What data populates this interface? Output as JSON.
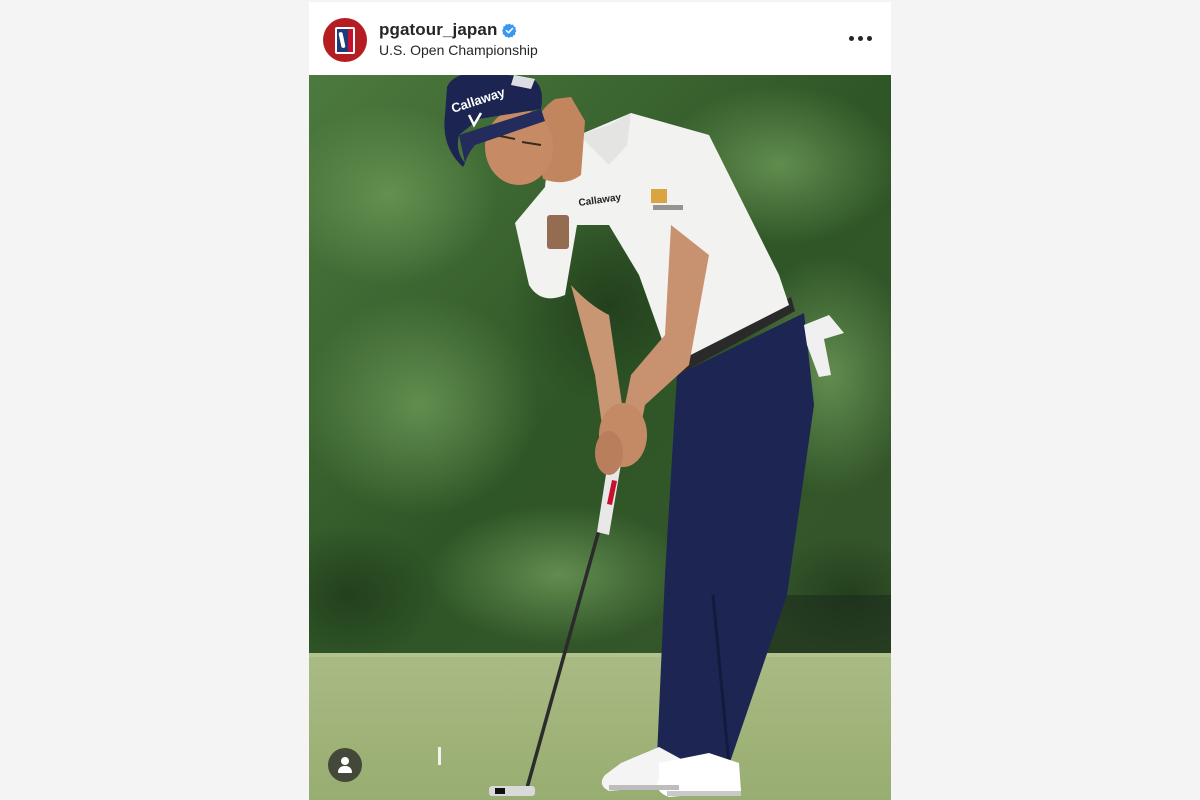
{
  "post": {
    "username": "pgatour_japan",
    "verified": true,
    "location": "U.S. Open Championship",
    "more_options_icon": "more-horizontal-icon"
  },
  "photo": {
    "cap_brand": "Callaway",
    "shirt_brand": "Callaway",
    "tagged_users_icon": "user-icon"
  },
  "colors": {
    "avatar_red": "#b51d22",
    "verified_blue": "#3897f0",
    "text": "#262626"
  }
}
